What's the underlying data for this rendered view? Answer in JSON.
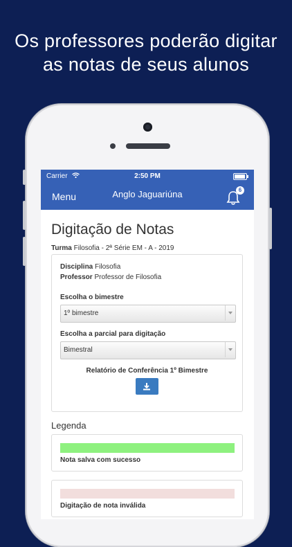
{
  "promo": {
    "line1": "Os professores poderão digitar",
    "line2": "as notas de seus alunos"
  },
  "status": {
    "carrier": "Carrier",
    "time": "2:50 PM"
  },
  "navbar": {
    "menu_label": "Menu",
    "title": "Anglo Jaguariúna",
    "notification_count": "6"
  },
  "page": {
    "heading": "Digitação de Notas",
    "turma_label": "Turma",
    "turma_value": "Filosofia - 2ª Série EM - A - 2019"
  },
  "form": {
    "disciplina_label": "Disciplina",
    "disciplina_value": "Filosofia",
    "professor_label": "Professor",
    "professor_value": "Professor de Filosofia",
    "bimestre_label": "Escolha o bimestre",
    "bimestre_selected": "1º bimestre",
    "parcial_label": "Escolha a parcial para digitação",
    "parcial_selected": "Bimestral",
    "report_label": "Relatório de Conferência 1º Bimestre"
  },
  "legend": {
    "title": "Legenda",
    "items": [
      {
        "label": "Nota salva com sucesso",
        "color": "#8ef17f"
      },
      {
        "label": "Digitação de nota inválida",
        "color": "#f2dedd"
      }
    ]
  },
  "colors": {
    "brand": "#3661b6",
    "background": "#0d1f54",
    "download_button": "#3a7bc0"
  }
}
